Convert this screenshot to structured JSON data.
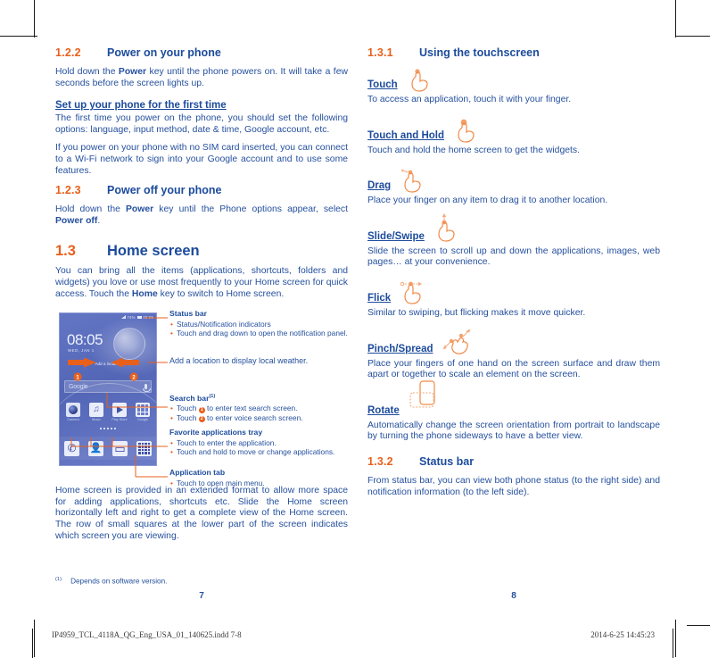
{
  "left_page": {
    "page_number": "7",
    "sections": [
      {
        "num": "1.2.2",
        "title": "Power on your phone",
        "paras": [
          "Hold down the Power key until the phone powers on. It will take a few seconds before the screen lights up."
        ]
      }
    ],
    "s122_num": "1.2.2",
    "s122_title": "Power on your phone",
    "s122_p1_a": "Hold down the ",
    "s122_p1_b": "Power",
    "s122_p1_c": " key until the phone powers on. It will take a few seconds before the screen lights up.",
    "setup_heading": "Set up your phone for the first time",
    "setup_p1": "The first time you power on the phone, you should set the following options: language, input method, date & time, Google account, etc.",
    "setup_p2": "If you power on your phone with no SIM card inserted, you can connect to a Wi-Fi network to sign into your Google account and to use some features.",
    "s123_num": "1.2.3",
    "s123_title": "Power off your phone",
    "s123_p1_a": "Hold down the ",
    "s123_p1_b": "Power",
    "s123_p1_c": " key until the Phone options appear, select ",
    "s123_p1_d": "Power off",
    "s123_p1_e": ".",
    "s13_num": "1.3",
    "s13_title": "Home screen",
    "s13_p1_a": "You can bring all the items (applications, shortcuts, folders and widgets) you love or use most frequently to your Home screen for quick access. Touch the ",
    "s13_p1_b": "Home",
    "s13_p1_c": " key to switch to Home screen.",
    "closing_para": "Home screen is provided in an extended format to allow more space for adding applications, shortcuts etc. Slide the Home screen horizontally left and right to get a complete view of the Home screen. The row of small squares at the lower part of the screen indicates which screen you are viewing.",
    "footnote_mark": "(1)",
    "footnote_text": "Depends on software version."
  },
  "phone_mock": {
    "status_time": "08:05",
    "status_battery": "74%",
    "clock": "08:05",
    "date": "WED, JAN 1",
    "add_location": "Add a location",
    "search_placeholder": "Google",
    "marker_one": "1",
    "marker_two": "2",
    "apps": [
      {
        "label": "Camera",
        "icon": "camera-icon"
      },
      {
        "label": "Music",
        "icon": "music-icon"
      },
      {
        "label": "Play Store",
        "icon": "play-store-icon"
      },
      {
        "label": "Google",
        "icon": "google-folder-icon"
      }
    ],
    "tray": [
      {
        "name": "phone-icon"
      },
      {
        "name": "contacts-icon"
      },
      {
        "name": "messaging-icon"
      },
      {
        "name": "app-drawer-icon"
      }
    ]
  },
  "callouts": [
    {
      "title": "Status bar",
      "items": [
        "Status/Notification indicators",
        "Touch and drag down to open the notification panel."
      ]
    },
    {
      "plain": "Add a location to display local weather."
    },
    {
      "title": "Search bar",
      "title_sup": "(1)",
      "items_prefix": [
        {
          "pre": "Touch ",
          "num": "1",
          "post": " to enter text search screen."
        },
        {
          "pre": "Touch ",
          "num": "2",
          "post": " to enter voice search screen."
        }
      ]
    },
    {
      "title": "Favorite applications tray",
      "items": [
        "Touch to enter the application.",
        "Touch and hold to move or change applications."
      ]
    },
    {
      "title": "Application tab",
      "items": [
        "Touch to open main menu."
      ]
    }
  ],
  "right_page": {
    "page_number": "8",
    "s131_num": "1.3.1",
    "s131_title": "Using the touchscreen",
    "gestures": [
      {
        "label": "Touch",
        "icon": "hand-touch-icon",
        "desc": "To access an application, touch it with your finger."
      },
      {
        "label": "Touch and Hold",
        "icon": "hand-touch-hold-icon",
        "desc": "Touch and hold the home screen to get the widgets."
      },
      {
        "label": "Drag",
        "icon": "hand-drag-icon",
        "desc": "Place your finger on any item to drag it to another location."
      },
      {
        "label": "Slide/Swipe",
        "icon": "hand-slide-icon",
        "desc": "Slide the screen to scroll up and down the applications, images, web pages… at your convenience."
      },
      {
        "label": "Flick",
        "icon": "hand-flick-icon",
        "desc": "Similar to swiping, but flicking makes it move quicker."
      },
      {
        "label": "Pinch/Spread",
        "icon": "hand-pinch-spread-icon",
        "desc": "Place your fingers of one hand on the screen surface and draw them apart or together to scale an element on the screen."
      },
      {
        "label": "Rotate",
        "icon": "phone-rotate-icon",
        "desc": "Automatically change the screen orientation from portrait to landscape by turning the phone sideways to have a better view."
      }
    ],
    "s132_num": "1.3.2",
    "s132_title": "Status bar",
    "s132_p1": "From status bar, you can view both phone status (to the right side) and notification information (to the left side)."
  },
  "print_footer": {
    "file": "IP4959_TCL_4118A_QG_Eng_USA_01_140625.indd   7-8",
    "timestamp": "2014-6-25   14:45:23"
  },
  "colors": {
    "heading_orange": "#e8601c",
    "heading_blue": "#1c4b9c",
    "body_blue": "#25509e",
    "phone_screen": "#5b6fbe"
  }
}
